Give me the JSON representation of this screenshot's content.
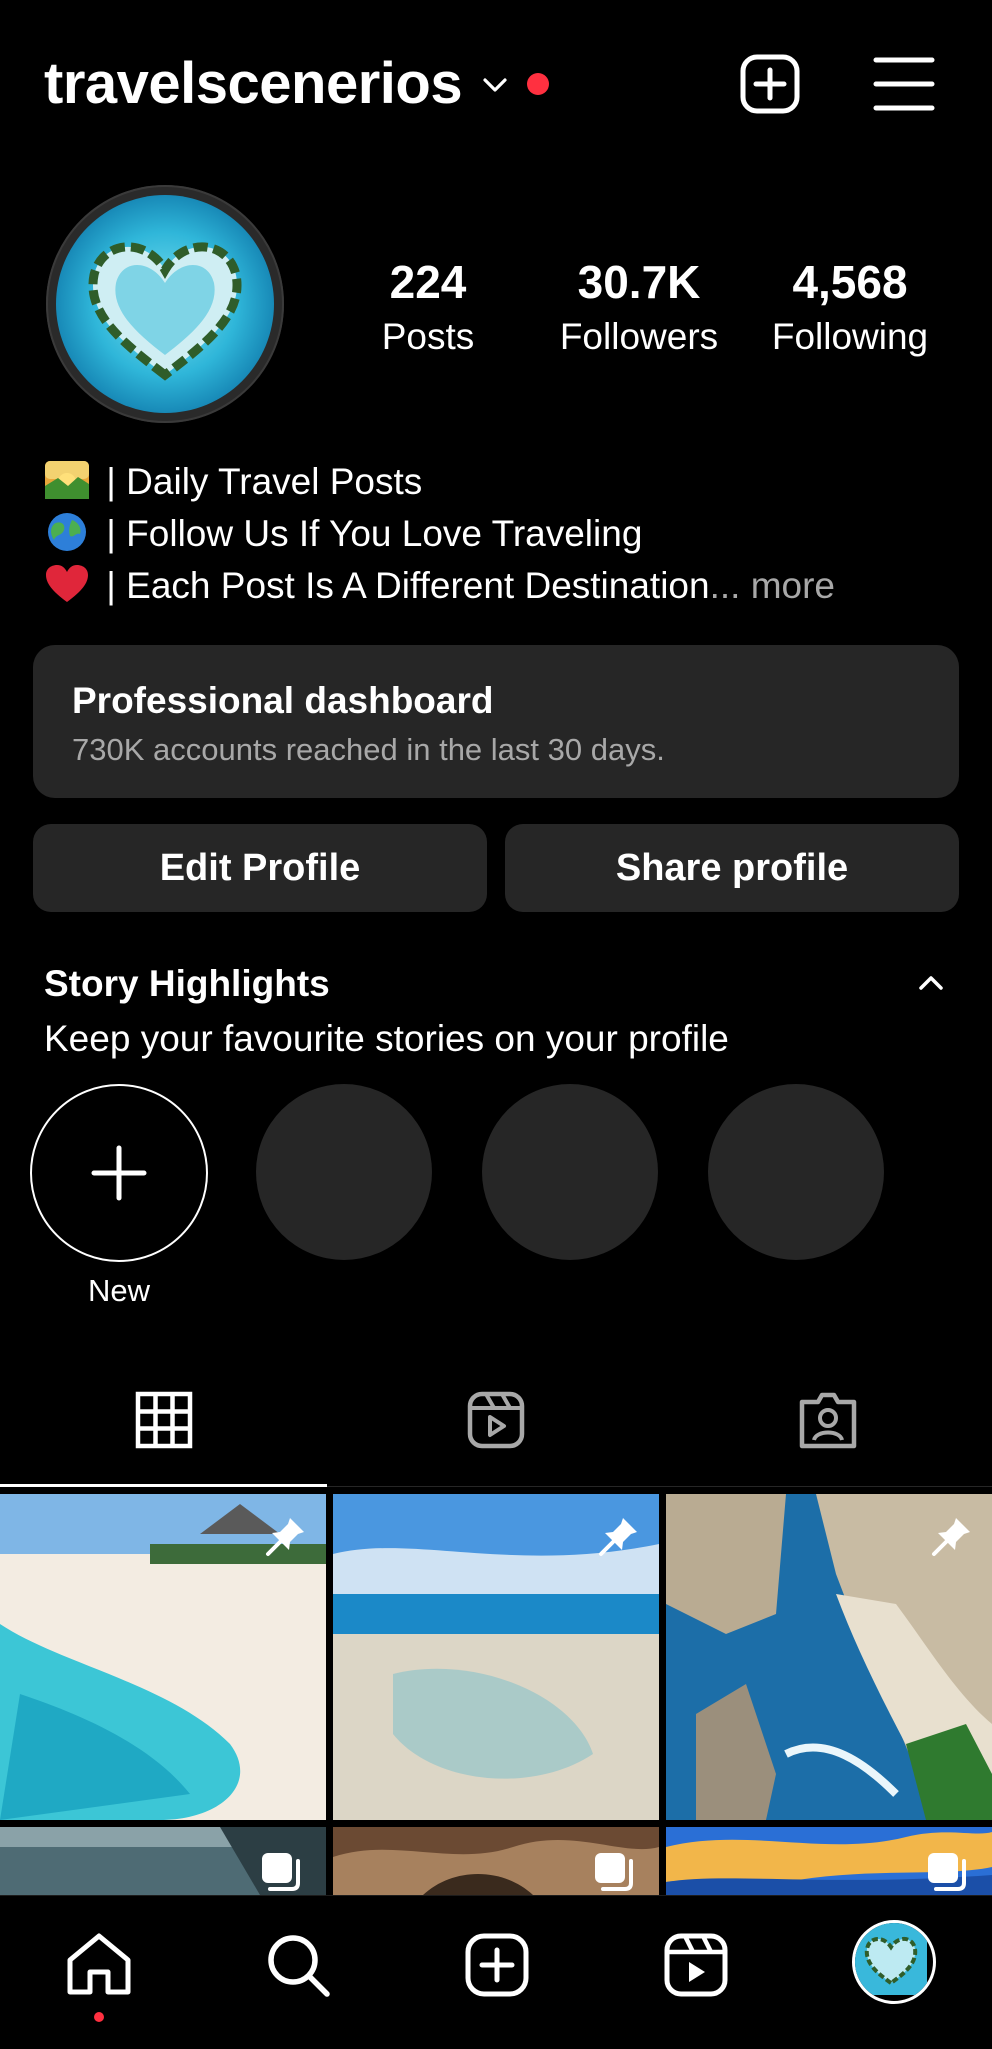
{
  "header": {
    "username": "travelscenerios",
    "icons": [
      "chevron-down-icon",
      "notification-dot",
      "create-post-icon",
      "menu-icon"
    ]
  },
  "profile": {
    "stats": [
      {
        "value": "224",
        "label": "Posts"
      },
      {
        "value": "30.7K",
        "label": "Followers"
      },
      {
        "value": "4,568",
        "label": "Following"
      }
    ],
    "bio": [
      {
        "emoji": "sunrise-emoji",
        "text": " | Daily Travel Posts"
      },
      {
        "emoji": "globe-emoji",
        "text": " | Follow Us If You Love Traveling"
      },
      {
        "emoji": "red-heart-emoji",
        "text": " | Each Post Is A Different Destination",
        "more": "... more"
      }
    ]
  },
  "dashboard": {
    "title": "Professional dashboard",
    "subtitle": "730K accounts reached in the last 30 days."
  },
  "buttons": {
    "edit": "Edit Profile",
    "share": "Share profile"
  },
  "highlights": {
    "title": "Story Highlights",
    "subtitle": "Keep your favourite stories on your profile",
    "new_label": "New"
  },
  "tabs": [
    "grid-icon",
    "reels-icon",
    "tagged-icon"
  ],
  "colors": {
    "background": "#000000",
    "surface": "#262626",
    "muted_text": "#a8a8a8",
    "accent_red": "#ff3040"
  },
  "nav": [
    "home-icon",
    "search-icon",
    "create-icon",
    "reels-icon",
    "profile-avatar"
  ]
}
